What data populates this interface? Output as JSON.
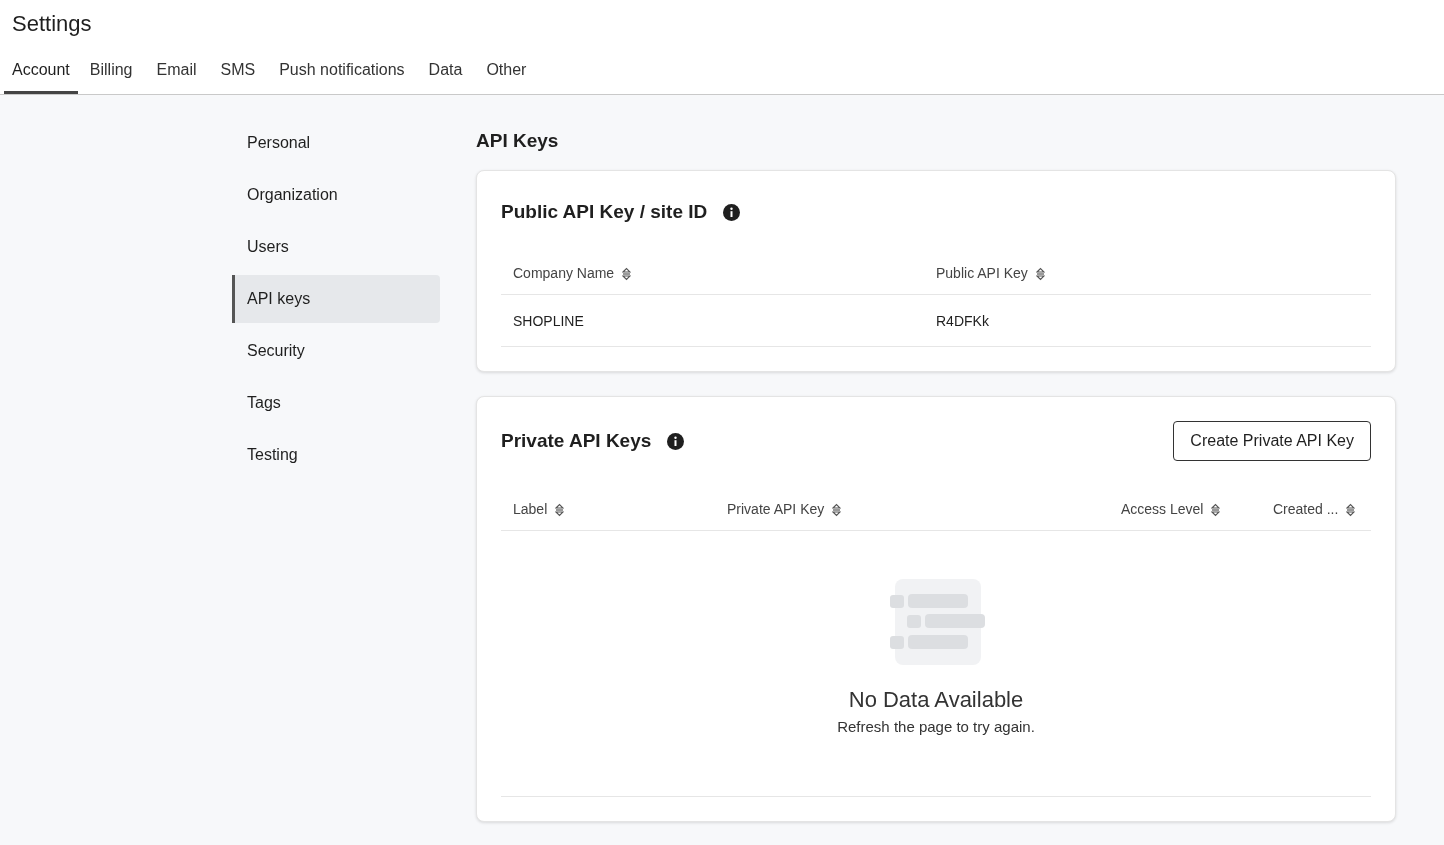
{
  "header": {
    "title": "Settings"
  },
  "tabs": [
    {
      "label": "Account",
      "selected": true
    },
    {
      "label": "Billing",
      "selected": false
    },
    {
      "label": "Email",
      "selected": false
    },
    {
      "label": "SMS",
      "selected": false
    },
    {
      "label": "Push notifications",
      "selected": false
    },
    {
      "label": "Data",
      "selected": false
    },
    {
      "label": "Other",
      "selected": false
    }
  ],
  "sidebar": {
    "items": [
      {
        "label": "Personal",
        "selected": false
      },
      {
        "label": "Organization",
        "selected": false
      },
      {
        "label": "Users",
        "selected": false
      },
      {
        "label": "API keys",
        "selected": true
      },
      {
        "label": "Security",
        "selected": false
      },
      {
        "label": "Tags",
        "selected": false
      },
      {
        "label": "Testing",
        "selected": false
      }
    ]
  },
  "page_title": "API Keys",
  "public_card": {
    "title": "Public API Key / site ID",
    "columns": [
      "Company Name",
      "Public API Key"
    ],
    "rows": [
      [
        "SHOPLINE",
        "R4DFKk"
      ]
    ]
  },
  "private_card": {
    "title": "Private API Keys",
    "button": "Create Private API Key",
    "columns": [
      "Label",
      "Private API Key",
      "Access Level",
      "Created ..."
    ],
    "empty": {
      "title": "No Data Available",
      "message": "Refresh the page to try again."
    }
  }
}
